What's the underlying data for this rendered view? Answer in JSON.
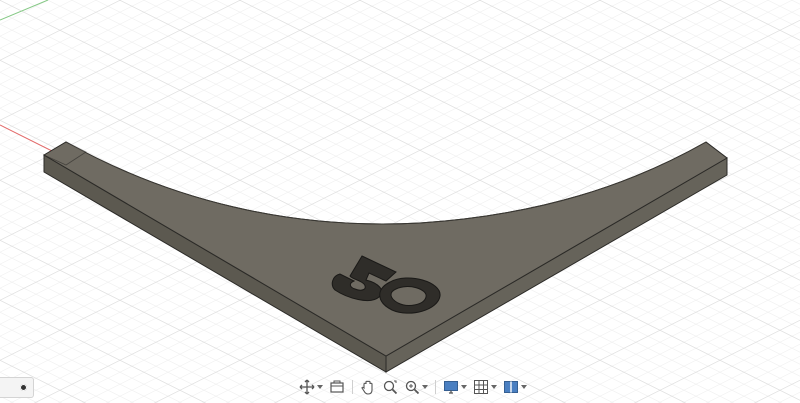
{
  "viewport": {
    "background": "#ffffff",
    "grid_minor_color": "#ececec",
    "grid_major_color": "#d9d9d9",
    "axis_x_color": "#e26a6a",
    "axis_y_color": "#86c986",
    "model": {
      "description_text": "50",
      "top_face_color": "#6f6b62",
      "side_face_color": "#5a574f",
      "edge_color": "#2b2a27"
    }
  },
  "side_panel": {
    "icon": "display-settings-icon"
  },
  "toolbar": {
    "buttons": [
      {
        "id": "orbit",
        "icon": "orbit-move-icon",
        "has_dropdown": true
      },
      {
        "id": "look-at",
        "icon": "look-at-icon",
        "has_dropdown": false
      },
      {
        "id": "pan",
        "icon": "pan-hand-icon",
        "has_dropdown": false
      },
      {
        "id": "zoom",
        "icon": "zoom-icon",
        "has_dropdown": false
      },
      {
        "id": "fit",
        "icon": "zoom-window-icon",
        "has_dropdown": true
      },
      {
        "id": "display",
        "icon": "display-settings-icon",
        "has_dropdown": true
      },
      {
        "id": "grid",
        "icon": "grid-snaps-icon",
        "has_dropdown": true
      },
      {
        "id": "viewports",
        "icon": "viewports-icon",
        "has_dropdown": true
      }
    ]
  }
}
